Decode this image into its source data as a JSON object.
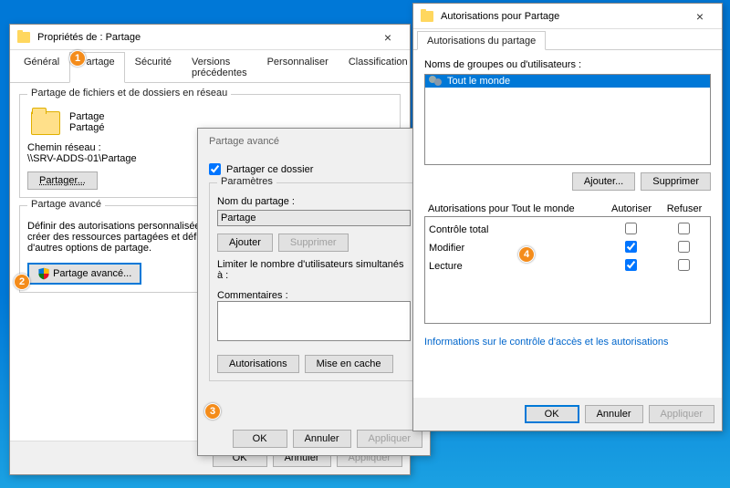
{
  "properties": {
    "title": "Propriétés de : Partage",
    "tabs": [
      "Général",
      "Partage",
      "Sécurité",
      "Versions précédentes",
      "Personnaliser",
      "Classification"
    ],
    "active_tab": "Partage",
    "group1_legend": "Partage de fichiers et de dossiers en réseau",
    "share_name": "Partage",
    "share_status": "Partagé",
    "netpath_label": "Chemin réseau :",
    "netpath_value": "\\\\SRV-ADDS-01\\Partage",
    "share_btn": "Partager...",
    "group2_legend": "Partage avancé",
    "adv_desc": "Définir des autorisations personnalisées, créer des ressources partagées et définir d'autres options de partage.",
    "adv_btn": "Partage avancé...",
    "ok": "OK",
    "cancel": "Annuler",
    "apply": "Appliquer"
  },
  "advanced": {
    "title": "Partage avancé",
    "share_checkbox": "Partager ce dossier",
    "params_legend": "Paramètres",
    "name_label": "Nom du partage :",
    "name_value": "Partage",
    "add": "Ajouter",
    "remove": "Supprimer",
    "limit_label": "Limiter le nombre d'utilisateurs simultanés à :",
    "comments_label": "Commentaires :",
    "comments_value": "",
    "perm_btn": "Autorisations",
    "cache_btn": "Mise en cache",
    "ok": "OK",
    "cancel": "Annuler",
    "apply": "Appliquer"
  },
  "perms": {
    "title": "Autorisations pour Partage",
    "tab": "Autorisations du partage",
    "groups_label": "Noms de groupes ou d'utilisateurs :",
    "group_item": "Tout le monde",
    "add": "Ajouter...",
    "remove": "Supprimer",
    "perm_for": "Autorisations pour Tout le monde",
    "col_allow": "Autoriser",
    "col_deny": "Refuser",
    "rows": [
      {
        "label": "Contrôle total",
        "allow": false,
        "deny": false
      },
      {
        "label": "Modifier",
        "allow": true,
        "deny": false
      },
      {
        "label": "Lecture",
        "allow": true,
        "deny": false
      }
    ],
    "info_link": "Informations sur le contrôle d'accès et les autorisations",
    "ok": "OK",
    "cancel": "Annuler",
    "apply": "Appliquer"
  },
  "markers": {
    "1": "1",
    "2": "2",
    "3": "3",
    "4": "4"
  }
}
